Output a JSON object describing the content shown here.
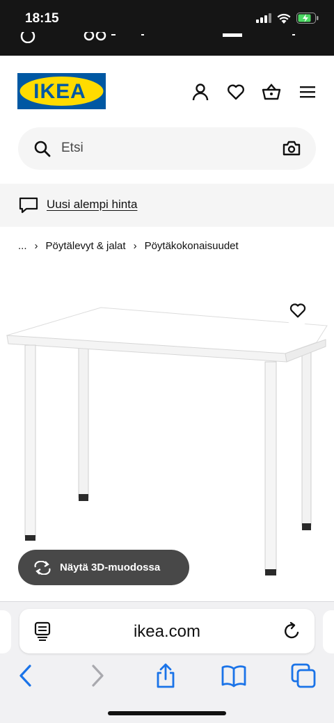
{
  "status_bar": {
    "time": "18:15",
    "icons": [
      "cellular-signal-icon",
      "wifi-icon",
      "battery-charging-icon"
    ]
  },
  "header": {
    "logo_text": "IKEA",
    "brand_colors": {
      "blue": "#0058A3",
      "yellow": "#FFDB00"
    },
    "icons": [
      "user-icon",
      "heart-icon",
      "basket-icon",
      "menu-icon"
    ]
  },
  "search": {
    "placeholder": "Etsi",
    "icons": [
      "search-icon",
      "camera-icon"
    ]
  },
  "banner": {
    "link_text": "Uusi alempi hinta",
    "icon": "chat-bubble-icon"
  },
  "breadcrumb": {
    "items": [
      "...",
      "Pöytälevyt & jalat",
      "Pöytäkokonaisuudet"
    ],
    "separator": "›"
  },
  "product": {
    "image": "white-desk-image",
    "favorite_icon": "heart-icon",
    "view_3d_label": "Näytä 3D-muodossa",
    "view_3d_icon": "rotate-3d-icon"
  },
  "browser": {
    "url": "ikea.com",
    "icons": [
      "reader-icon",
      "reload-icon",
      "back-icon",
      "forward-icon",
      "share-icon",
      "bookmarks-icon",
      "tabs-icon"
    ]
  }
}
